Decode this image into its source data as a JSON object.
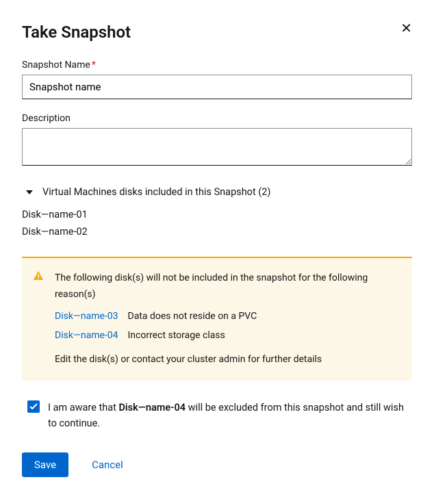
{
  "modal": {
    "title": "Take Snapshot"
  },
  "form": {
    "name_label": "Snapshot Name",
    "name_value": "Snapshot name",
    "description_label": "Description",
    "description_value": ""
  },
  "disks_section": {
    "toggle_label": "Virtual Machines disks included in this Snapshot (2)",
    "items": [
      "Disk—name-01",
      "Disk—name-02"
    ]
  },
  "warning": {
    "header": "The following disk(s) will not be included in the snapshot for the following reason(s)",
    "excluded": [
      {
        "name": "Disk—name-03",
        "reason": "Data does not reside on a PVC"
      },
      {
        "name": "Disk—name-04",
        "reason": "Incorrect storage class"
      }
    ],
    "footer": "Edit the disk(s) or contact your cluster admin for further details"
  },
  "consent": {
    "prefix": "I am aware that ",
    "bold": "Disk—name-04",
    "suffix": " will be excluded from this snapshot and still wish to continue.",
    "checked": true
  },
  "actions": {
    "save": "Save",
    "cancel": "Cancel"
  }
}
